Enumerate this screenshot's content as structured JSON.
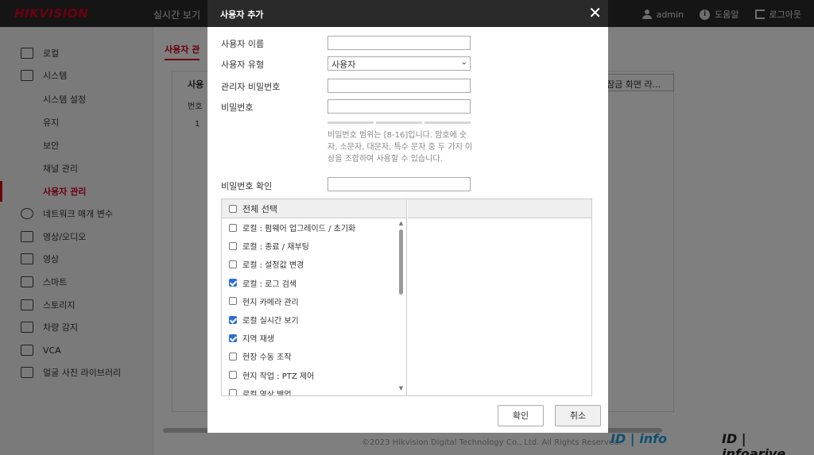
{
  "header": {
    "logo": "HIKVISION",
    "nav_live": "실시간 보기",
    "user_label": "admin",
    "help_label": "도움말",
    "logout_label": "로그아웃"
  },
  "sidebar": {
    "items": [
      {
        "label": "로컬",
        "icon": "monitor-icon"
      },
      {
        "label": "시스템",
        "icon": "system-icon"
      },
      {
        "label": "시스템 설정"
      },
      {
        "label": "유지"
      },
      {
        "label": "보안"
      },
      {
        "label": "채널 관리"
      },
      {
        "label": "사용자 관리"
      },
      {
        "label": "네트워크 매개 변수",
        "icon": "globe-icon"
      },
      {
        "label": "영상/오디오",
        "icon": "audio-video-icon"
      },
      {
        "label": "영상",
        "icon": "image-icon"
      },
      {
        "label": "스마트",
        "icon": "calendar-icon"
      },
      {
        "label": "스토리지",
        "icon": "storage-icon"
      },
      {
        "label": "차량 감지",
        "icon": "vehicle-icon"
      },
      {
        "label": "VCA",
        "icon": "vca-icon"
      },
      {
        "label": "얼굴 사진 라이브러리",
        "icon": "face-icon"
      }
    ]
  },
  "background": {
    "tab_label": "사용자 관",
    "table_title": "사용",
    "col_no": "번호",
    "row_no": "1",
    "lock_button": "잠금 화면 라...",
    "footer": "©2023 Hikvision Digital Technology Co., Ltd. All Rights Reserved.",
    "brand_a": "ID | info",
    "brand_b": "ID | infoarive"
  },
  "dialog": {
    "title": "사용자 추가",
    "username_label": "사용자 이름",
    "username_value": "",
    "usertype_label": "사용자 유형",
    "usertype_value": "사용자",
    "admin_pw_label": "관리자 비밀번호",
    "password_label": "비밀번호",
    "hint": "비밀번호 범위는 [8-16]입니다. 암호에 숫자, 소문자, 대문자, 특수 문자 중 두 가지 이상을 조합하여 사용할 수 있습니다.",
    "confirm_label": "비밀번호 확인",
    "select_all": "전체 선택",
    "permissions": [
      {
        "label": "로컬 : 펌웨어 업그레이드 / 초기화",
        "checked": false
      },
      {
        "label": "로컬 : 종료 / 재부팅",
        "checked": false
      },
      {
        "label": "로컬 : 설정값 변경",
        "checked": false
      },
      {
        "label": "로컬 : 로그 검색",
        "checked": true
      },
      {
        "label": "현지 카메라 관리",
        "checked": false
      },
      {
        "label": "로컬 실시간 보기",
        "checked": true
      },
      {
        "label": "지역 재생",
        "checked": true
      },
      {
        "label": "현장 수동 조작",
        "checked": false
      },
      {
        "label": "현지 작업 : PTZ 제어",
        "checked": false
      },
      {
        "label": "로컬 영상 백업",
        "checked": false
      }
    ],
    "ok_button": "확인",
    "cancel_button": "취소"
  },
  "colors": {
    "accent": "#d6001c",
    "checkbox": "#2f6fd6",
    "header_bg": "#2a2a2a"
  }
}
